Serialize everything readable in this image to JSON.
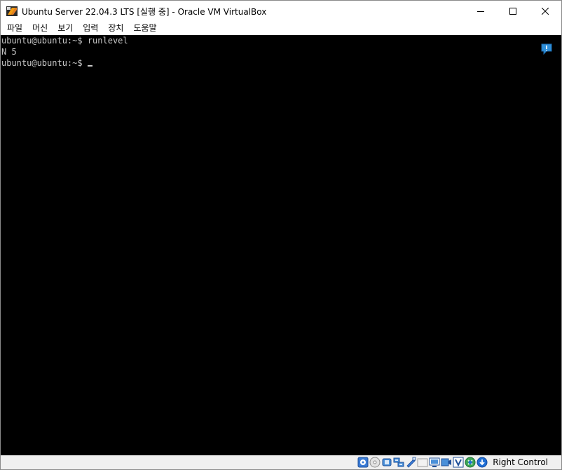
{
  "window": {
    "title": "Ubuntu Server 22.04.3 LTS [실행 중] - Oracle VM VirtualBox",
    "controls": {
      "minimize": "minimize-icon",
      "maximize": "maximize-icon",
      "close": "close-icon"
    }
  },
  "menu": {
    "items": [
      "파일",
      "머신",
      "보기",
      "입력",
      "장치",
      "도움말"
    ]
  },
  "console": {
    "lines": [
      "ubuntu@ubuntu:~$ runlevel",
      "N 5",
      "ubuntu@ubuntu:~$"
    ],
    "text_color": "#c8c8c8",
    "background": "#000000"
  },
  "statusbar": {
    "icons": [
      "hard-disk-icon",
      "optical-drive-icon",
      "audio-icon",
      "network-icon",
      "usb-icon",
      "shared-folders-icon",
      "display-icon",
      "recording-icon",
      "cpu-virtualization-icon",
      "mouse-integration-icon",
      "keyboard-capture-icon"
    ],
    "host_key": "Right Control"
  }
}
